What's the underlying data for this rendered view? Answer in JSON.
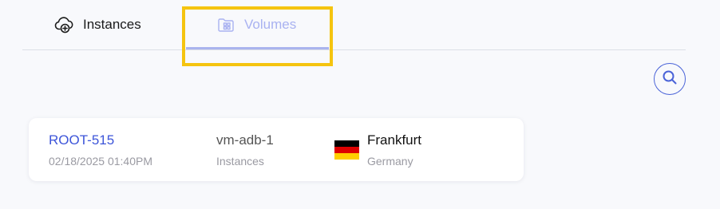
{
  "tabs": {
    "instances_label": "Instances",
    "volumes_label": "Volumes",
    "active": "Volumes"
  },
  "icons": {
    "instances": "cloud-plus-icon",
    "volumes": "folder-grid-icon",
    "search": "search-icon"
  },
  "colors": {
    "accent": "#3d55d9",
    "active_tab": "#a9b2f1",
    "highlight": "#f5c40f"
  },
  "volume": {
    "name": "ROOT-515",
    "created": "02/18/2025 01:40PM",
    "vm_name": "vm-adb-1",
    "vm_type": "Instances",
    "city": "Frankfurt",
    "country": "Germany",
    "flag_colors": [
      "#000000",
      "#dd0000",
      "#ffce00"
    ]
  }
}
